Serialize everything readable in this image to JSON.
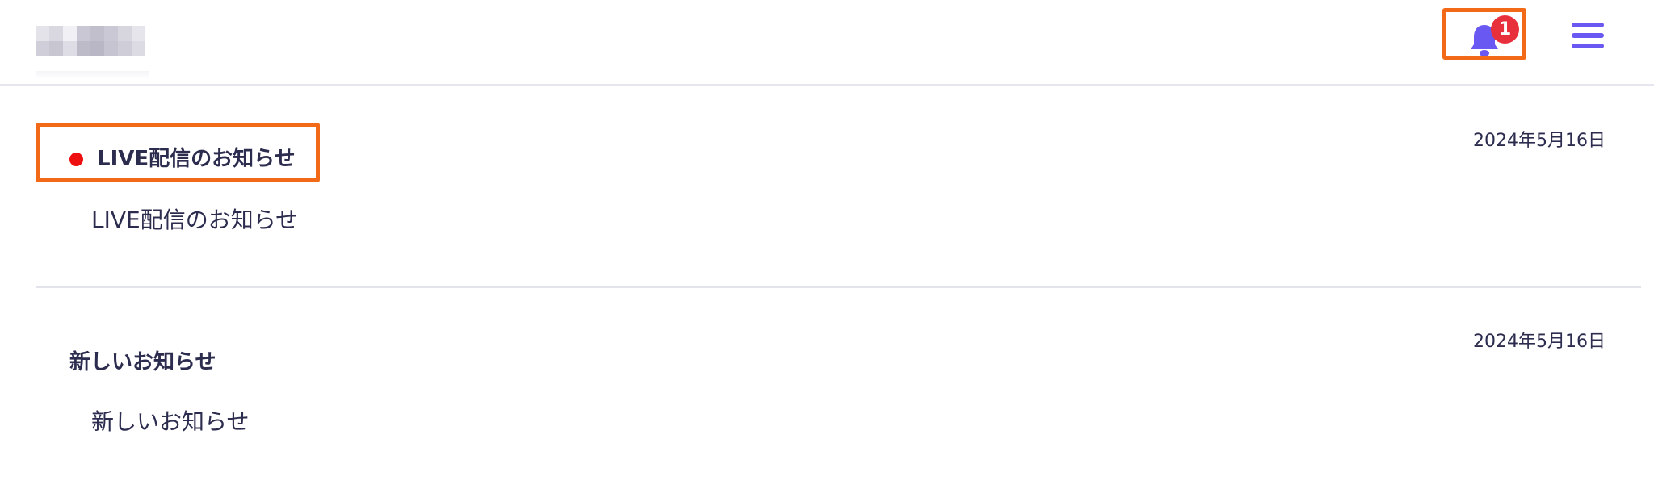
{
  "header": {
    "notification_count": "1",
    "logo_tiles": [
      "#e4e3ea",
      "#d9d8e1",
      "#f1f0f4",
      "#c9c7d3",
      "#c0bfcb",
      "#cac8d4",
      "#d7d5de",
      "#e6e5ec",
      "#d0cfd9",
      "#c8c6d1",
      "#dedde5",
      "#bdbbc8",
      "#b9b7c5",
      "#c6c4d0",
      "#cfcdd8",
      "#dcdbe3"
    ],
    "colors": {
      "accent": "#6a58f2",
      "badge": "#e8303d",
      "highlight_border": "#f26a17",
      "unread_dot": "#ee1010"
    }
  },
  "notifications": [
    {
      "title": "LIVE配信のお知らせ",
      "body": "LIVE配信のお知らせ",
      "date": "2024年5月16日",
      "unread": true
    },
    {
      "title": "新しいお知らせ",
      "body": "新しいお知らせ",
      "date": "2024年5月16日",
      "unread": false
    }
  ]
}
